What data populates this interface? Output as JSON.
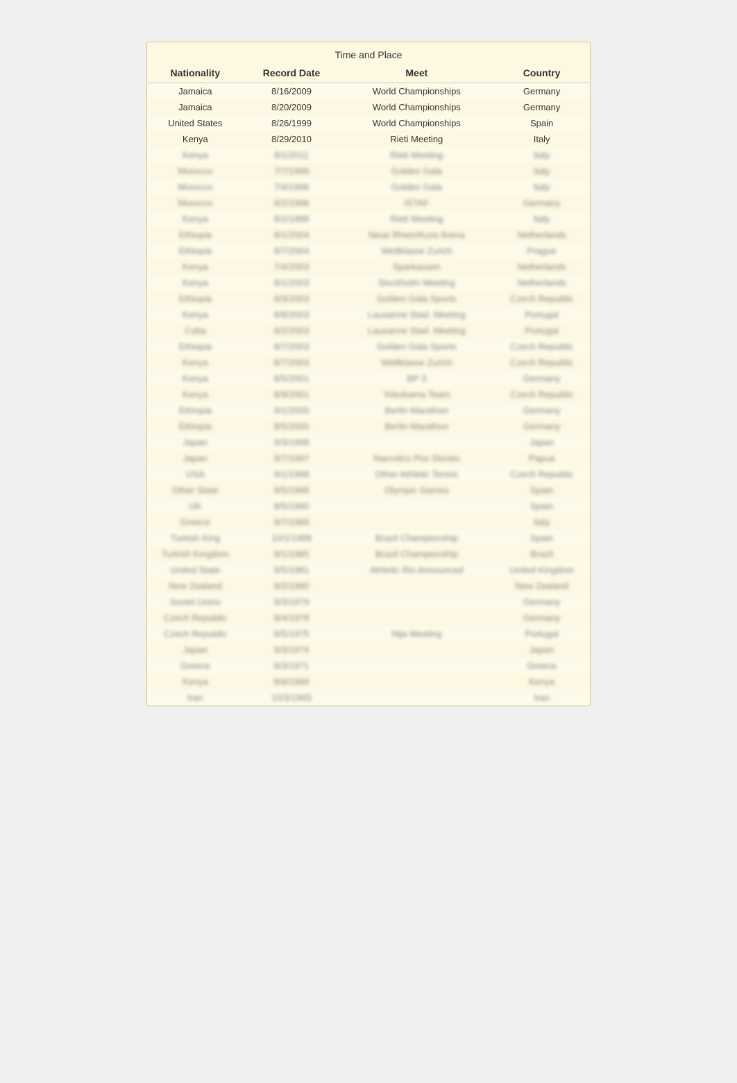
{
  "table": {
    "section_header": "Time and Place",
    "columns": [
      "Nationality",
      "Record Date",
      "Meet",
      "Country"
    ],
    "rows": [
      {
        "nationality": "Jamaica",
        "date": "8/16/2009",
        "meet": "World Championships",
        "country": "Germany",
        "blurred": false
      },
      {
        "nationality": "Jamaica",
        "date": "8/20/2009",
        "meet": "World Championships",
        "country": "Germany",
        "blurred": false
      },
      {
        "nationality": "United States",
        "date": "8/26/1999",
        "meet": "World Championships",
        "country": "Spain",
        "blurred": false
      },
      {
        "nationality": "Kenya",
        "date": "8/29/2010",
        "meet": "Rieti Meeting",
        "country": "Italy",
        "blurred": false
      },
      {
        "nationality": "Kenya",
        "date": "8/1/2011",
        "meet": "Rieti Meeting",
        "country": "Italy",
        "blurred": true
      },
      {
        "nationality": "Morocco",
        "date": "7/7/1999",
        "meet": "Golden Gala",
        "country": "Italy",
        "blurred": true
      },
      {
        "nationality": "Morocco",
        "date": "7/4/1998",
        "meet": "Golden Gala",
        "country": "Italy",
        "blurred": true
      },
      {
        "nationality": "Morocco",
        "date": "9/2/1996",
        "meet": "ISTAF",
        "country": "Germany",
        "blurred": true
      },
      {
        "nationality": "Kenya",
        "date": "8/2/1988",
        "meet": "Rieti Meeting",
        "country": "Italy",
        "blurred": true
      },
      {
        "nationality": "Ethiopia",
        "date": "9/1/2004",
        "meet": "Neue Rhein/Kuss Arena",
        "country": "Netherlands",
        "blurred": true
      },
      {
        "nationality": "Ethiopia",
        "date": "8/7/2004",
        "meet": "Weltklasse Zurich",
        "country": "Prague",
        "blurred": true
      },
      {
        "nationality": "Kenya",
        "date": "7/4/2003",
        "meet": "Sparkassen",
        "country": "Netherlands",
        "blurred": true
      },
      {
        "nationality": "Kenya",
        "date": "8/1/2003",
        "meet": "Stockholm Meeting",
        "country": "Netherlands",
        "blurred": true
      },
      {
        "nationality": "Ethiopia",
        "date": "9/3/2003",
        "meet": "Golden Gala Sports",
        "country": "Czech Republic",
        "blurred": true
      },
      {
        "nationality": "Kenya",
        "date": "8/8/2003",
        "meet": "Lausanne Stad. Meeting",
        "country": "Portugal",
        "blurred": true
      },
      {
        "nationality": "Cuba",
        "date": "9/2/2003",
        "meet": "Lausanne Stad. Meeting",
        "country": "Portugal",
        "blurred": true
      },
      {
        "nationality": "Ethiopia",
        "date": "9/7/2003",
        "meet": "Golden Gala Sports",
        "country": "Czech Republic",
        "blurred": true
      },
      {
        "nationality": "Kenya",
        "date": "8/7/2003",
        "meet": "Weltklasse Zurich",
        "country": "Czech Republic",
        "blurred": true
      },
      {
        "nationality": "Kenya",
        "date": "8/5/2001",
        "meet": "BP 3",
        "country": "Germany",
        "blurred": true
      },
      {
        "nationality": "Kenya",
        "date": "8/9/2001",
        "meet": "Yokohama Team",
        "country": "Czech Republic",
        "blurred": true
      },
      {
        "nationality": "Ethiopia",
        "date": "9/1/2000",
        "meet": "Berlin Marathon",
        "country": "Germany",
        "blurred": true
      },
      {
        "nationality": "Ethiopia",
        "date": "8/5/2000",
        "meet": "Berlin Marathon",
        "country": "Germany",
        "blurred": true
      },
      {
        "nationality": "Japan",
        "date": "9/3/1998",
        "meet": "",
        "country": "Japan",
        "blurred": true
      },
      {
        "nationality": "Japan",
        "date": "9/7/1997",
        "meet": "Narcotics Pos Stories",
        "country": "Papua",
        "blurred": true
      },
      {
        "nationality": "USA",
        "date": "9/1/1998",
        "meet": "Other Athletic Tennis",
        "country": "Czech Republic",
        "blurred": true
      },
      {
        "nationality": "Other State",
        "date": "9/5/1998",
        "meet": "Olympic Games",
        "country": "Spain",
        "blurred": true
      },
      {
        "nationality": "UK",
        "date": "8/5/1990",
        "meet": "",
        "country": "Spain",
        "blurred": true
      },
      {
        "nationality": "Greece",
        "date": "9/7/1989",
        "meet": "",
        "country": "Italy",
        "blurred": true
      },
      {
        "nationality": "Turkish King",
        "date": "10/1/1988",
        "meet": "Brazil Championship",
        "country": "Spain",
        "blurred": true
      },
      {
        "nationality": "Turkish Kingdom",
        "date": "9/1/1985",
        "meet": "Brazil Championship",
        "country": "Brazil",
        "blurred": true
      },
      {
        "nationality": "United State",
        "date": "8/5/1981",
        "meet": "Athletic Rio Announced",
        "country": "United Kingdom",
        "blurred": true
      },
      {
        "nationality": "New Zealand",
        "date": "9/2/1980",
        "meet": "",
        "country": "New Zealand",
        "blurred": true
      },
      {
        "nationality": "Soviet Uniov",
        "date": "9/3/1979",
        "meet": "",
        "country": "Germany",
        "blurred": true
      },
      {
        "nationality": "Czech Republic",
        "date": "9/4/1978",
        "meet": "",
        "country": "Germany",
        "blurred": true
      },
      {
        "nationality": "Czech Republic",
        "date": "8/5/1975",
        "meet": "Nija Meeting",
        "country": "Portugal",
        "blurred": true
      },
      {
        "nationality": "Japan",
        "date": "9/3/1974",
        "meet": "",
        "country": "Japan",
        "blurred": true
      },
      {
        "nationality": "Greece",
        "date": "8/3/1971",
        "meet": "",
        "country": "Greece",
        "blurred": true
      },
      {
        "nationality": "Kenya",
        "date": "8/9/1969",
        "meet": "",
        "country": "Kenya",
        "blurred": true
      },
      {
        "nationality": "Iran",
        "date": "10/3/1965",
        "meet": "",
        "country": "Iran",
        "blurred": true
      }
    ]
  }
}
